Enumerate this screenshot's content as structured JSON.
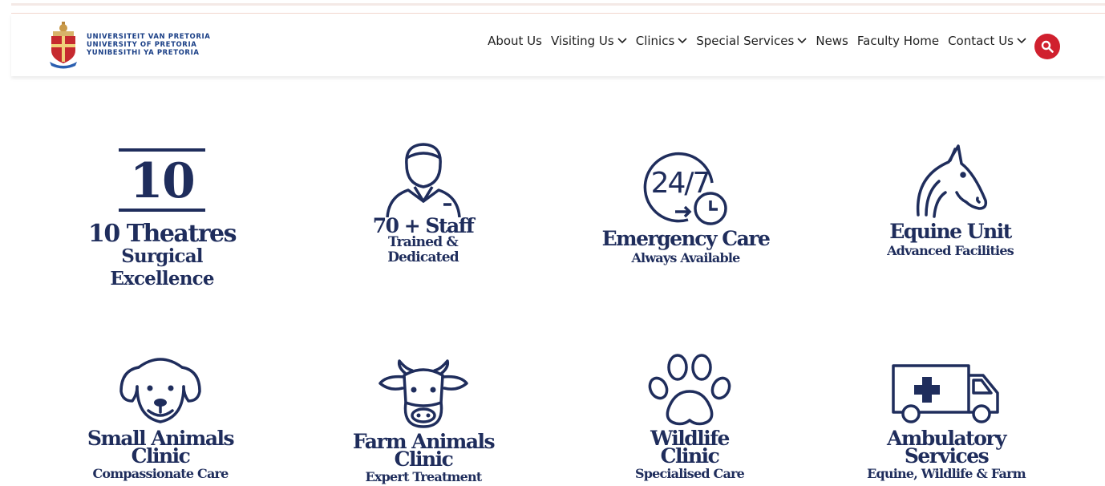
{
  "brand": {
    "line1": "UNIVERSITEIT VAN PRETORIA",
    "line2": "UNIVERSITY OF PRETORIA",
    "line3": "YUNIBESITHI YA PRETORIA"
  },
  "nav": {
    "items": [
      {
        "label": "About Us",
        "dropdown": false
      },
      {
        "label": "Visiting Us",
        "dropdown": true
      },
      {
        "label": "Clinics",
        "dropdown": true
      },
      {
        "label": "Special Services",
        "dropdown": true
      },
      {
        "label": "News",
        "dropdown": false
      },
      {
        "label": "Faculty Home",
        "dropdown": false
      },
      {
        "label": "Contact Us",
        "dropdown": true
      }
    ],
    "search_icon": "search-icon"
  },
  "colors": {
    "navy": "#1f2d5c",
    "accent_red": "#d0202e"
  },
  "features": [
    {
      "icon": "theatre-number-icon",
      "number": "10",
      "title": "10 Theatres",
      "subtitle": "Surgical Excellence"
    },
    {
      "icon": "staff-person-icon",
      "title": "70 + Staff",
      "subtitle1": "Trained &",
      "subtitle2": "Dedicated"
    },
    {
      "icon": "clock-24-7-icon",
      "number": "24/7",
      "title": "Emergency Care",
      "subtitle": "Always Available"
    },
    {
      "icon": "horse-icon",
      "title": "Equine Unit",
      "subtitle": "Advanced Facilities"
    },
    {
      "icon": "dog-icon",
      "title1": "Small Animals",
      "title2": "Clinic",
      "subtitle": "Compassionate Care"
    },
    {
      "icon": "cow-icon",
      "title1": "Farm Animals",
      "title2": "Clinic",
      "subtitle": "Expert Treatment"
    },
    {
      "icon": "paw-icon",
      "title1": "Wildlife",
      "title2": "Clinic",
      "subtitle": "Specialised Care"
    },
    {
      "icon": "ambulance-icon",
      "title1": "Ambulatory",
      "title2": "Services",
      "subtitle": "Equine, Wildlife & Farm"
    }
  ]
}
